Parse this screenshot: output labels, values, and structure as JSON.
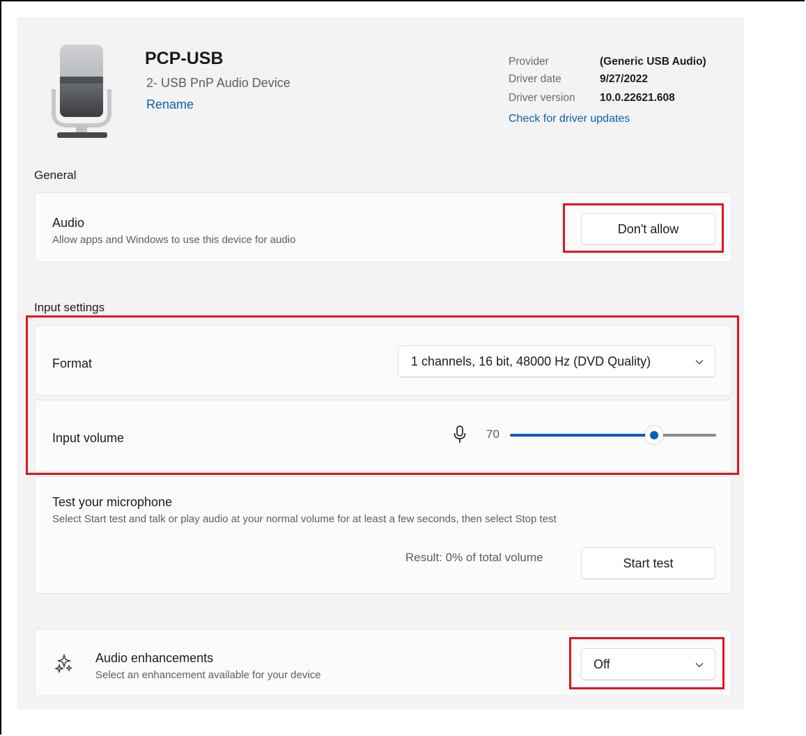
{
  "device": {
    "name": "PCP-USB",
    "subtitle": "2- USB PnP Audio Device",
    "rename_label": "Rename",
    "icon": "microphone-device-icon"
  },
  "driver": {
    "provider_label": "Provider",
    "provider_value": "(Generic USB Audio)",
    "date_label": "Driver date",
    "date_value": "9/27/2022",
    "version_label": "Driver version",
    "version_value": "10.0.22621.608",
    "update_link": "Check for driver updates"
  },
  "general": {
    "section_title": "General",
    "audio_title": "Audio",
    "audio_desc": "Allow apps and Windows to use this device for audio",
    "audio_button": "Don't allow"
  },
  "input_settings": {
    "section_title": "Input settings",
    "format_label": "Format",
    "format_value": "1 channels, 16 bit, 48000 Hz (DVD Quality)",
    "volume_label": "Input volume",
    "volume_value": "70",
    "volume_level": 0.7,
    "test_title": "Test your microphone",
    "test_desc": "Select Start test and talk or play audio at your normal volume for at least a few seconds, then select Stop test",
    "test_result": "Result: 0% of total volume",
    "test_button": "Start test"
  },
  "enhancements": {
    "title": "Audio enhancements",
    "desc": "Select an enhancement available for your device",
    "value": "Off",
    "icon": "sparkle-icon"
  },
  "colors": {
    "accent": "#005fb8",
    "link": "#0f5fa8",
    "highlight": "#e0141e",
    "panel": "#f3f3f3",
    "card": "#fbfbfb"
  }
}
